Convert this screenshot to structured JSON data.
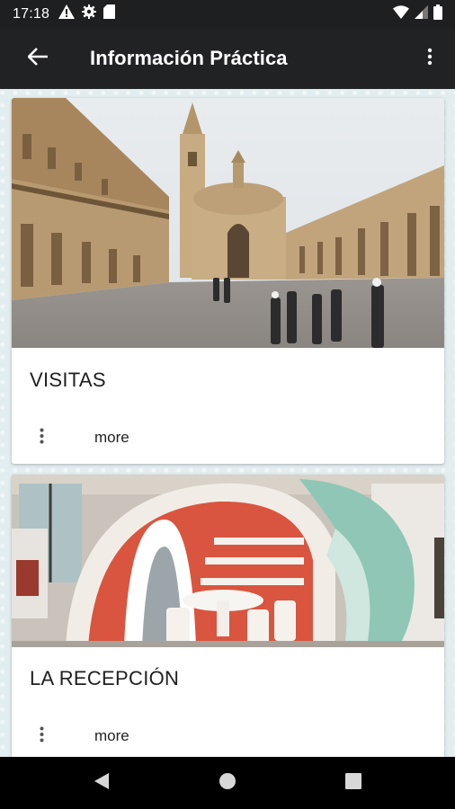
{
  "status_bar": {
    "time": "17:18",
    "left_icons": [
      "warning-icon",
      "settings-icon",
      "sd-card-icon"
    ],
    "right_icons": [
      "wifi-icon",
      "signal-icon",
      "battery-icon"
    ]
  },
  "toolbar": {
    "title": "Información Práctica",
    "back_icon": "arrow-back-icon",
    "menu_icon": "more-vert-icon"
  },
  "cards": [
    {
      "title": "VISITAS",
      "more_label": "more",
      "image": "photo-building-plaza"
    },
    {
      "title": "LA RECEPCIÓN",
      "more_label": "more",
      "image": "photo-reception-interior"
    }
  ],
  "nav_bar": {
    "icons": [
      "back-triangle-icon",
      "home-circle-icon",
      "recents-square-icon"
    ]
  },
  "colors": {
    "status_bar": "#1e1f21",
    "toolbar": "#212224",
    "background": "#e2edef",
    "card": "#ffffff"
  }
}
